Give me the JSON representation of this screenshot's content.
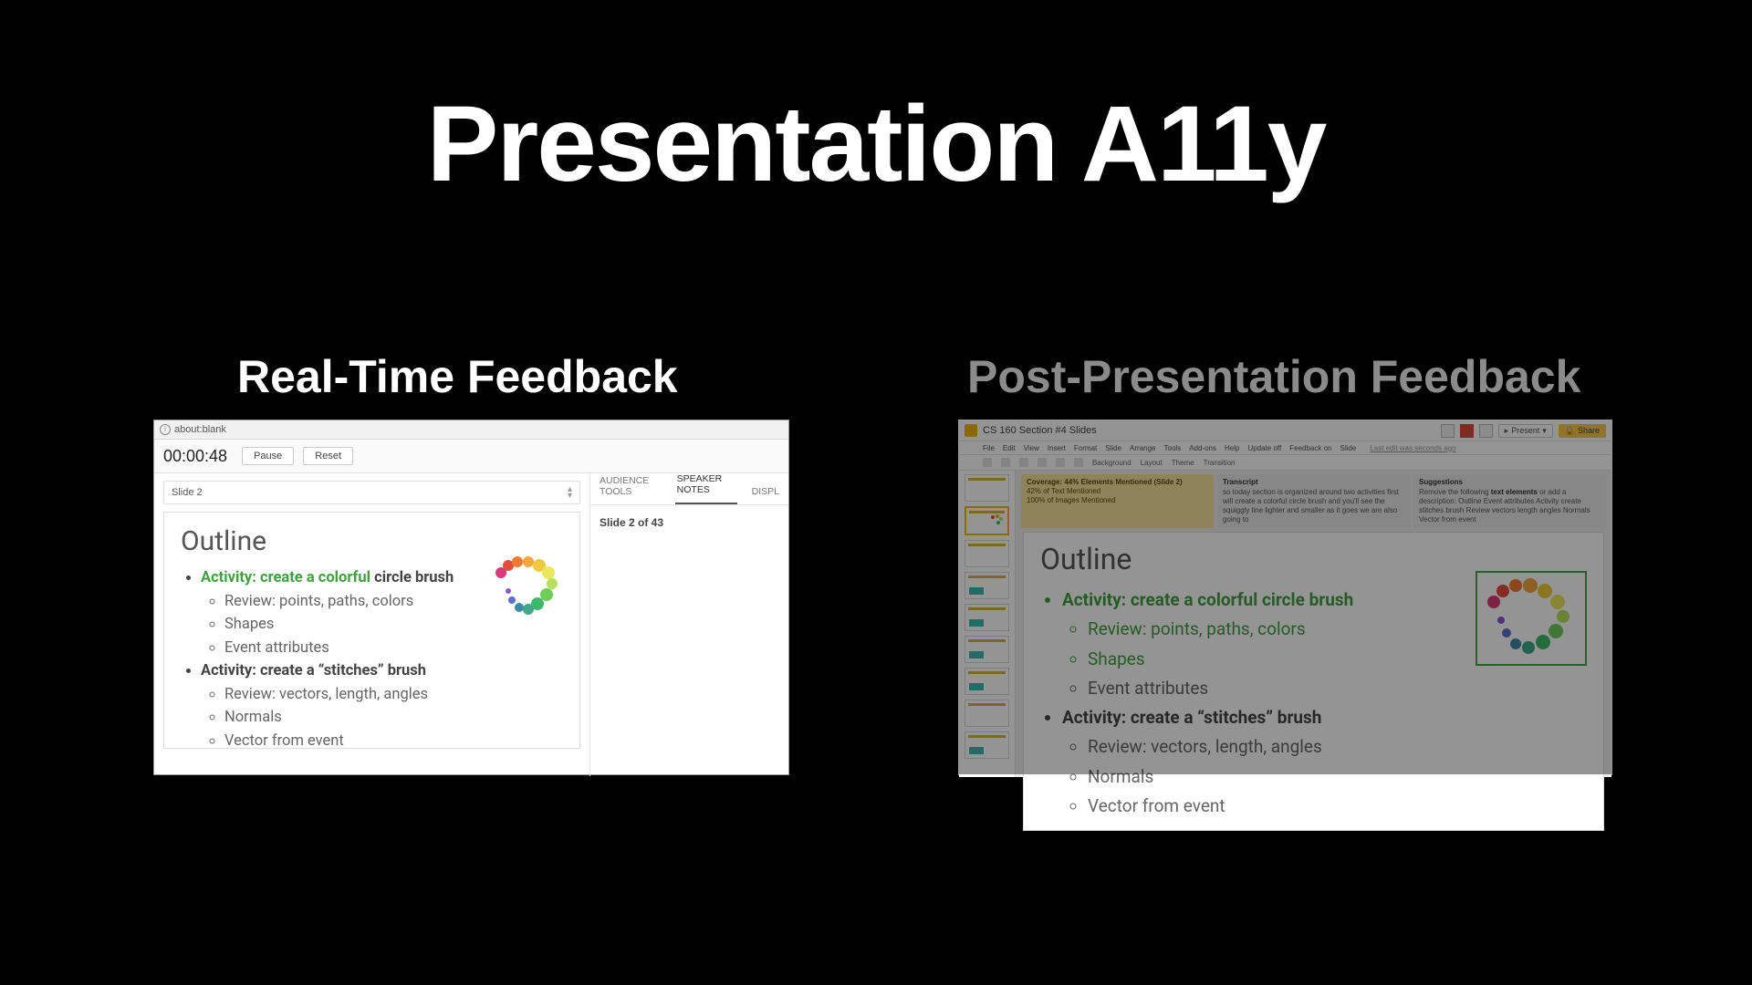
{
  "title": "Presentation A11y",
  "left": {
    "heading": "Real-Time Feedback",
    "addressbar": "about:blank",
    "timer": "00:00:48",
    "pause": "Pause",
    "reset": "Reset",
    "slide_chip": "Slide 2",
    "tabs": {
      "audience": "AUDIENCE TOOLS",
      "speaker": "SPEAKER NOTES",
      "display": "DISPL"
    },
    "notes_header": "Slide 2 of 43",
    "slide": {
      "title": "Outline",
      "b1_prefix": "Activity: create a colorful",
      "b1_suffix": " circle brush",
      "s1": "Review: points, paths, colors",
      "s2": "Shapes",
      "s3": "Event attributes",
      "b2": "Activity: create a “stitches” brush",
      "s4": "Review: vectors, length, angles",
      "s5": "Normals",
      "s6": "Vector from event"
    }
  },
  "right": {
    "heading": "Post-Presentation Feedback",
    "doc_title": "CS 160 Section #4 Slides",
    "present": "Present",
    "share": "Share",
    "menu": [
      "File",
      "Edit",
      "View",
      "Insert",
      "Format",
      "Slide",
      "Arrange",
      "Tools",
      "Add-ons",
      "Help",
      "Update off",
      "Feedback on",
      "Slide"
    ],
    "last_edit": "Last edit was seconds ago",
    "tools": [
      "Background",
      "Layout",
      "Theme",
      "Transition"
    ],
    "feedback": {
      "coverage_line": "Coverage: 44% Elements Mentioned (Slide 2)",
      "coverage_sub1": "42% of Text Mentioned",
      "coverage_sub2": "100% of Images Mentioned",
      "transcript_h": "Transcript",
      "transcript": "so today section is organized around two activities first will create a colorful circle brush and you'll see the squiggly line lighter and smaller as it goes we are also going to",
      "suggestions_h": "Suggestions",
      "suggestions_pre": "Remove the following ",
      "suggestions_bold": "text elements",
      "suggestions_post": " or add a description: Outline Event attributes Activity create stitches brush Review vectors length angles Normals Vector from event"
    },
    "slide": {
      "title": "Outline",
      "b1": "Activity: create a colorful circle brush",
      "s1": "Review: points, paths, colors",
      "s2": "Shapes",
      "s3": "Event attributes",
      "b2": "Activity: create a “stitches” brush",
      "s4": "Review: vectors, length, angles",
      "s5": "Normals",
      "s6": "Vector from event"
    }
  }
}
